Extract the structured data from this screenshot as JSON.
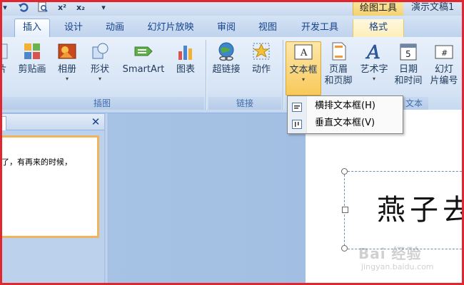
{
  "quick_access": {
    "undo_icon": "undo-icon",
    "superscript_label": "x²",
    "subscript_label": "x₂",
    "more_label": "▾"
  },
  "title_bar": {
    "context_group": "绘图工具",
    "doc_title": "演示文稿1"
  },
  "tabs": [
    {
      "label": "插入",
      "active": true
    },
    {
      "label": "设计"
    },
    {
      "label": "动画"
    },
    {
      "label": "幻灯片放映"
    },
    {
      "label": "审阅"
    },
    {
      "label": "视图"
    },
    {
      "label": "开发工具"
    },
    {
      "label": "格式",
      "context": true
    }
  ],
  "ribbon": {
    "illustrations": {
      "group_label": "插图",
      "items": [
        {
          "label": "片"
        },
        {
          "label": "剪贴画"
        },
        {
          "label": "相册",
          "has_caret": true
        },
        {
          "label": "形状",
          "has_caret": true
        },
        {
          "label": "SmartArt"
        },
        {
          "label": "图表"
        }
      ]
    },
    "links": {
      "group_label": "链接",
      "items": [
        {
          "label": "超链接"
        },
        {
          "label": "动作"
        }
      ]
    },
    "text": {
      "group_label": "文本",
      "items": [
        {
          "label": "文本框",
          "has_caret": true,
          "pressed": true
        },
        {
          "label": "页眉\n和页脚",
          "line1": "页眉",
          "line2": "和页脚"
        },
        {
          "label": "艺术字",
          "has_caret": true
        },
        {
          "label": "日期和时间",
          "line1": "日期",
          "line2": "和时间"
        },
        {
          "label": "幻灯片编号",
          "line1": "幻灯",
          "line2": "片编号"
        }
      ]
    }
  },
  "textbox_menu": {
    "items": [
      {
        "label": "横排文本框(H)",
        "icon": "horizontal-textbox-icon"
      },
      {
        "label": "垂直文本框(V)",
        "icon": "vertical-textbox-icon"
      }
    ]
  },
  "slides_pane": {
    "close_label": "✕",
    "thumbnail_text": "了，有再来的时候，"
  },
  "slide": {
    "text": "燕子去"
  },
  "watermark": {
    "line1": "Bai 经验",
    "line2": "jingyan.baidu.com"
  },
  "colors": {
    "frame": "#e0262f",
    "tab_text": "#15428b",
    "context_tab": "#f3cf6b"
  }
}
